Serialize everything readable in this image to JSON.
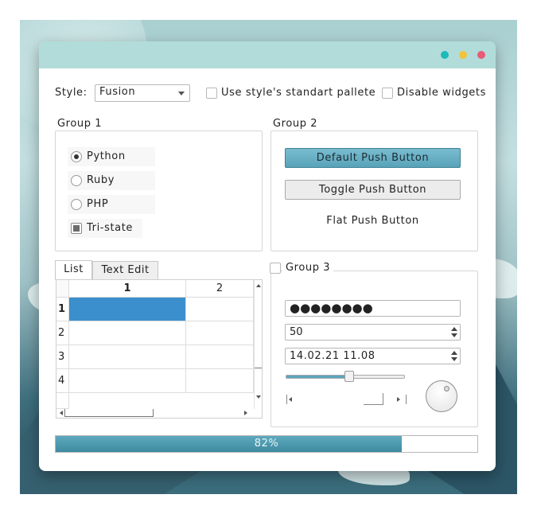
{
  "top": {
    "style_label": "Style:",
    "style_value": "Fusion",
    "use_palette_label": "Use style's standart pallete",
    "disable_widgets_label": "Disable widgets"
  },
  "group1": {
    "title": "Group 1",
    "options": [
      {
        "label": "Python",
        "checked": true
      },
      {
        "label": "Ruby",
        "checked": false
      },
      {
        "label": "PHP",
        "checked": false
      }
    ],
    "tristate_label": "Tri-state"
  },
  "group2": {
    "title": "Group 2",
    "default_button": "Default Push Button",
    "toggle_button": "Toggle Push Button",
    "flat_button": "Flat Push Button"
  },
  "tabs": {
    "list_label": "List",
    "text_edit_label": "Text Edit",
    "columns": [
      "1",
      "2"
    ],
    "rows": [
      "1",
      "2",
      "3",
      "4"
    ]
  },
  "group3": {
    "title": "Group 3",
    "password_value": "●●●●●●●●",
    "spin_value": "50",
    "datetime_value": "14.02.21 11.08",
    "slider_value": 0.5
  },
  "progress": {
    "value": 82,
    "text": "82%"
  },
  "colors": {
    "accent": "#58a3b9",
    "selection": "#3b8fcc",
    "titlebar": "#b2dcd9",
    "dot_cyan": "#1bbab8",
    "dot_yellow": "#f2c43a",
    "dot_red": "#ea5a78"
  }
}
